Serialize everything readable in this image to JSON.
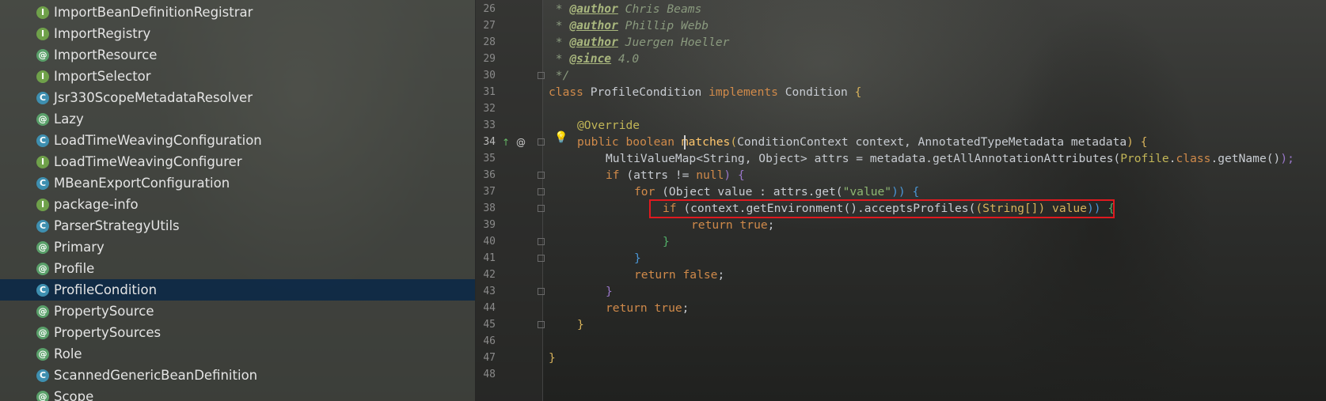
{
  "colors": {
    "tree_selected_bg": "#0d2946",
    "highlight_box": "#e0191f",
    "keyword": "#d08a4a",
    "annotation": "#c2b657",
    "string": "#8fb872",
    "method": "#ffc66d"
  },
  "tree": {
    "items": [
      {
        "icon": "interface-icon",
        "badge": "I",
        "label": "ImportBeanDefinitionRegistrar"
      },
      {
        "icon": "interface-icon",
        "badge": "I",
        "label": "ImportRegistry"
      },
      {
        "icon": "annotation-icon",
        "badge": "@",
        "label": "ImportResource"
      },
      {
        "icon": "interface-icon",
        "badge": "I",
        "label": "ImportSelector"
      },
      {
        "icon": "class-icon",
        "badge": "C",
        "label": "Jsr330ScopeMetadataResolver"
      },
      {
        "icon": "annotation-icon",
        "badge": "@",
        "label": "Lazy"
      },
      {
        "icon": "class-icon",
        "badge": "C",
        "label": "LoadTimeWeavingConfiguration"
      },
      {
        "icon": "interface-icon",
        "badge": "I",
        "label": "LoadTimeWeavingConfigurer"
      },
      {
        "icon": "class-icon",
        "badge": "C",
        "label": "MBeanExportConfiguration"
      },
      {
        "icon": "interface-icon",
        "badge": "I",
        "label": "package-info"
      },
      {
        "icon": "class-icon",
        "badge": "C",
        "label": "ParserStrategyUtils"
      },
      {
        "icon": "annotation-icon",
        "badge": "@",
        "label": "Primary"
      },
      {
        "icon": "annotation-icon",
        "badge": "@",
        "label": "Profile"
      },
      {
        "icon": "class-icon",
        "badge": "C",
        "label": "ProfileCondition",
        "selected": true
      },
      {
        "icon": "annotation-icon",
        "badge": "@",
        "label": "PropertySource"
      },
      {
        "icon": "annotation-icon",
        "badge": "@",
        "label": "PropertySources"
      },
      {
        "icon": "annotation-icon",
        "badge": "@",
        "label": "Role"
      },
      {
        "icon": "class-icon",
        "badge": "C",
        "label": "ScannedGenericBeanDefinition"
      },
      {
        "icon": "annotation-icon",
        "badge": "@",
        "label": "Scope"
      }
    ]
  },
  "editor": {
    "line_numbers": [
      "26",
      "27",
      "28",
      "29",
      "30",
      "31",
      "32",
      "33",
      "34",
      "35",
      "36",
      "37",
      "38",
      "39",
      "40",
      "41",
      "42",
      "43",
      "44",
      "45",
      "46",
      "47",
      "48"
    ],
    "line_numbers_current": "34",
    "gutter": {
      "implements_marker": "↑",
      "override_marker": "@",
      "intention_bulb": "💡"
    },
    "lines": {
      "l26_prefix": " * ",
      "l26_tag": "@author",
      "l26_rest": " Chris Beams",
      "l27_prefix": " * ",
      "l27_tag": "@author",
      "l27_rest": " Phillip Webb",
      "l28_prefix": " * ",
      "l28_tag": "@author",
      "l28_rest": " Juergen Hoeller",
      "l29_prefix": " * ",
      "l29_tag": "@since",
      "l29_rest": " 4.0",
      "l30": " */",
      "l31_kw": "class",
      "l31_name": " ProfileCondition ",
      "l31_kw2": "implements",
      "l31_iface": " Condition ",
      "l31_brace": "{",
      "l33_ann": "@Override",
      "l34_kw": "public boolean ",
      "l34_fn": "matches",
      "l34_p1": "(",
      "l34_params": "ConditionContext context, AnnotatedTypeMetadata metadata",
      "l34_p2": ") ",
      "l34_brace": "{",
      "l35_a": "MultiValueMap<String, Object> attrs = metadata.getAllAnnotationAttributes(",
      "l35_cls": "Profile",
      "l35_dot": ".",
      "l35_kw": "class",
      "l35_b": ".getName()",
      "l35_end": ");",
      "l36_kw": "if",
      "l36_a": " (attrs != ",
      "l36_kw2": "null",
      "l36_b": ") ",
      "l36_brace": "{",
      "l37_kw": "for",
      "l37_a": " (Object value : attrs.get(",
      "l37_str": "\"value\"",
      "l37_b": ")) ",
      "l37_brace": "{",
      "l38_kw": "if",
      "l38_a": " (context.getEnvironment().acceptsProfiles(",
      "l38_b": "(String[]) value",
      "l38_c": ")) ",
      "l38_brace": "{",
      "l39_kw": "return true",
      "l39_end": ";",
      "l40": "}",
      "l41": "}",
      "l42_kw": "return false",
      "l42_end": ";",
      "l43": "}",
      "l44_kw": "return true",
      "l44_end": ";",
      "l45": "}",
      "l47": "}"
    }
  }
}
